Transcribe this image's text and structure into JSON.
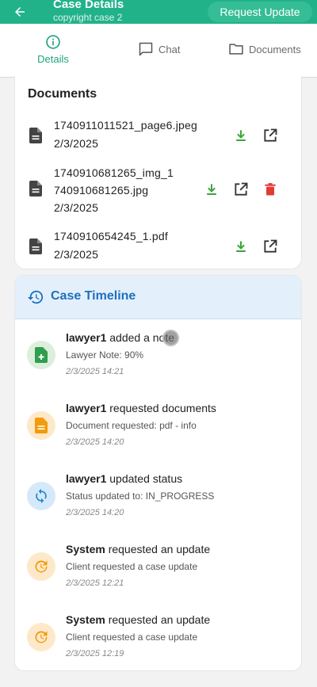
{
  "header": {
    "title": "Case Details",
    "subtitle": "copyright case 2",
    "request_button": "Request Update",
    "back_icon": "arrow-left-icon",
    "color": "#22b28a"
  },
  "tabs": [
    {
      "label": "Details",
      "icon": "info-icon",
      "active": true
    },
    {
      "label": "Chat",
      "icon": "chat-icon",
      "active": false
    },
    {
      "label": "Documents",
      "icon": "folder-icon",
      "active": false
    }
  ],
  "documents": {
    "heading": "Documents",
    "items": [
      {
        "name": "1740911011521_page6.jpeg",
        "date": "2/3/2025",
        "deletable": false
      },
      {
        "name_line1": "1740910681265_img_1",
        "name_line2": "740910681265.jpg",
        "date": "2/3/2025",
        "deletable": true
      },
      {
        "name": "1740910654245_1.pdf",
        "date": "2/3/2025",
        "deletable": false
      }
    ],
    "colors": {
      "download": "#3aa63a",
      "delete": "#e53935",
      "open": "#333333"
    }
  },
  "timeline": {
    "heading": "Case Timeline",
    "items": [
      {
        "actor": "lawyer1",
        "action": " added a note",
        "detail": "Lawyer Note: 90%",
        "time": "2/3/2025 14:21",
        "icon": "note-add-icon",
        "color": "#2e9e4f",
        "bg": "#dcefdc"
      },
      {
        "actor": "lawyer1",
        "action": " requested documents",
        "detail": "Document requested: pdf - info",
        "time": "2/3/2025 14:20",
        "icon": "document-icon",
        "color": "#f29b0b",
        "bg": "#fde9c9"
      },
      {
        "actor": "lawyer1",
        "action": " updated status",
        "detail": "Status updated to: IN_PROGRESS",
        "time": "2/3/2025 14:20",
        "icon": "sync-icon",
        "color": "#1e88d6",
        "bg": "#d6e9fa"
      },
      {
        "actor": "System",
        "action": " requested an update",
        "detail": "Client requested a case update",
        "time": "2/3/2025 12:21",
        "icon": "update-icon",
        "color": "#f29b0b",
        "bg": "#fde9c9"
      },
      {
        "actor": "System",
        "action": " requested an update",
        "detail": "Client requested a case update",
        "time": "2/3/2025 12:19",
        "icon": "update-icon",
        "color": "#f29b0b",
        "bg": "#fde9c9"
      }
    ]
  }
}
